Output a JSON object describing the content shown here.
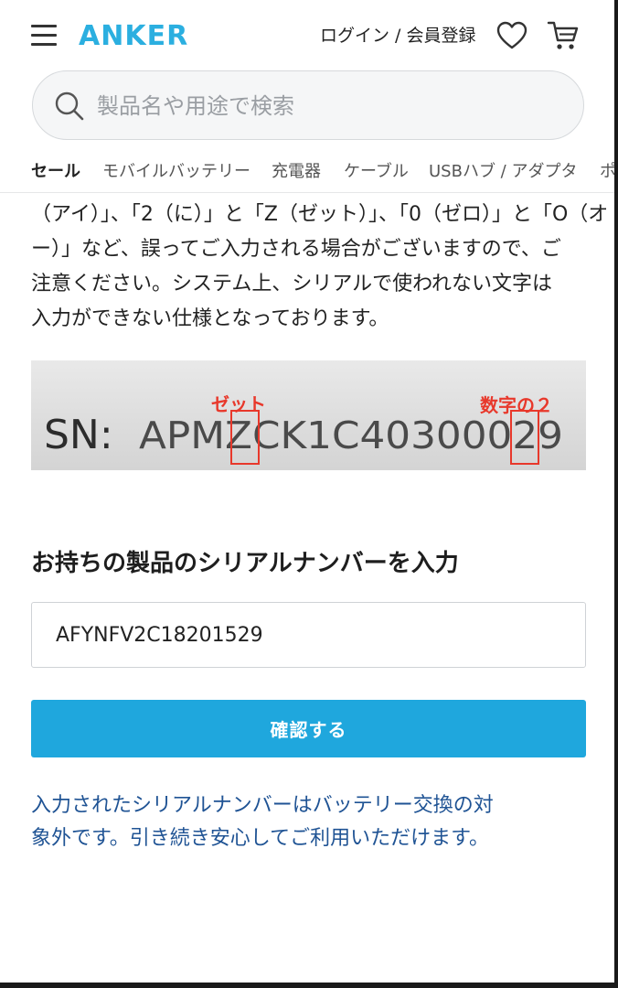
{
  "header": {
    "brand": "ANKER",
    "login_label": "ログイン / 会員登録",
    "icons": {
      "menu": "hamburger-menu-icon",
      "wishlist": "heart-icon",
      "cart": "cart-icon",
      "search": "search-icon"
    },
    "brand_color": "#2bafe0"
  },
  "search": {
    "placeholder": "製品名や用途で検索"
  },
  "categories": [
    {
      "label": "セール",
      "active": true
    },
    {
      "label": "モバイルバッテリー",
      "active": false
    },
    {
      "label": "充電器",
      "active": false
    },
    {
      "label": "ケーブル",
      "active": false
    },
    {
      "label": "USBハブ / アダプタ",
      "active": false
    },
    {
      "label": "ポ",
      "active": false
    }
  ],
  "notice": {
    "lines": [
      "（アイ）」、「2（に）」と「Z（ゼット）」、「0（ゼロ）」と「O（オ",
      "ー）」など、誤ってご入力される場合がございますので、ご",
      "注意ください。システム上、シリアルで使われない文字は",
      "入力ができない仕様となっております。"
    ]
  },
  "serial_image": {
    "prefix": "SN:",
    "serial": "APMZCK1C40300029",
    "annotation_zed": "ゼット",
    "annotation_two": "数字の２",
    "annotation_color": "#e8382b"
  },
  "form": {
    "heading": "お持ちの製品のシリアルナンバーを入力",
    "serial_value": "AFYNFV2C18201529",
    "submit_label": "確認する",
    "button_color": "#1fa7dd"
  },
  "result": {
    "lines": [
      "入力されたシリアルナンバーはバッテリー交換の対",
      "象外です。引き続き安心してご利用いただけます。"
    ],
    "color": "#1f5394"
  }
}
